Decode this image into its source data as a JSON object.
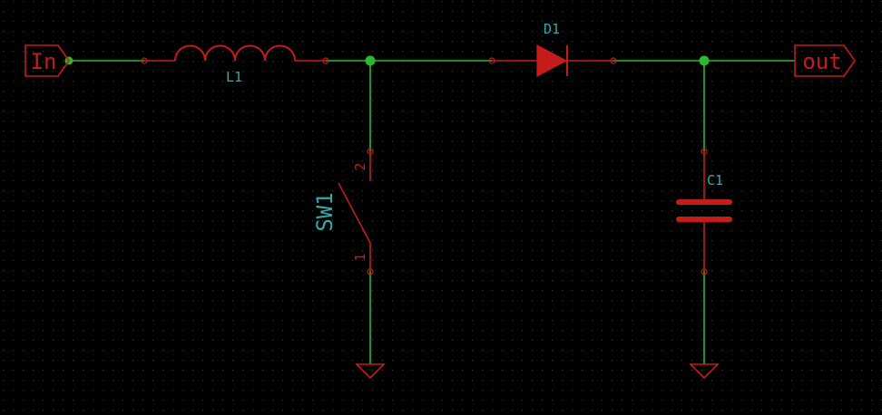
{
  "colors": {
    "background": "#000000",
    "grid": "#3a3a3a",
    "wire": "#2db82d",
    "component": "#c41b1b",
    "reference": "#33aaaa",
    "pin": "#c41b1b"
  },
  "ports": {
    "input": "In",
    "output": "out"
  },
  "components": {
    "inductor": {
      "ref": "L1",
      "type": "inductor"
    },
    "diode": {
      "ref": "D1",
      "type": "diode"
    },
    "switch": {
      "ref": "SW1",
      "type": "switch",
      "pin_top": "2",
      "pin_bottom": "1"
    },
    "capacitor": {
      "ref": "C1",
      "type": "capacitor"
    }
  },
  "grounds": [
    "ground-symbol",
    "ground-symbol"
  ]
}
